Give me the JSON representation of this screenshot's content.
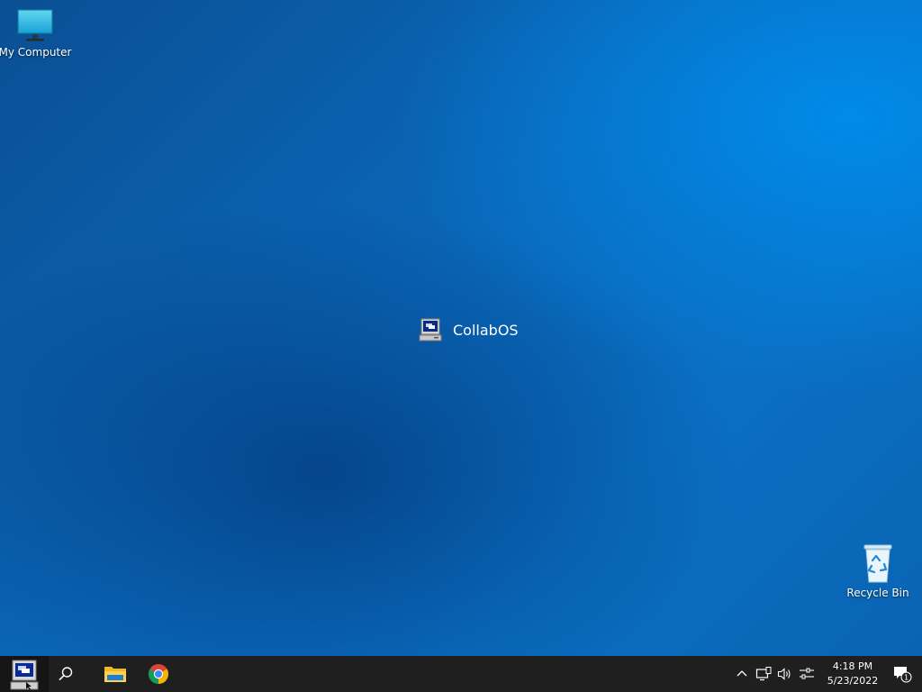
{
  "desktop": {
    "icons": [
      {
        "label": "My Computer",
        "icon": "monitor-icon"
      },
      {
        "label": "Recycle Bin",
        "icon": "recycle-bin-icon"
      }
    ],
    "center_logo": {
      "label": "CollabOS",
      "icon": "collabos-computer-icon"
    }
  },
  "taskbar": {
    "start": {
      "icon": "collabos-start-icon"
    },
    "search": {
      "icon": "search-icon"
    },
    "pinned": [
      {
        "icon": "file-explorer-icon"
      },
      {
        "icon": "chrome-icon"
      }
    ],
    "tray": {
      "icons": [
        "chevron-up-icon",
        "network-icon",
        "volume-icon",
        "settings-sliders-icon"
      ],
      "time": "4:18 PM",
      "date": "5/23/2022",
      "notification_count": "1"
    }
  },
  "colors": {
    "taskbar": "#1f1f1f",
    "wallpaper_dark": "#0a4f94",
    "wallpaper_light": "#0a8ee8"
  }
}
